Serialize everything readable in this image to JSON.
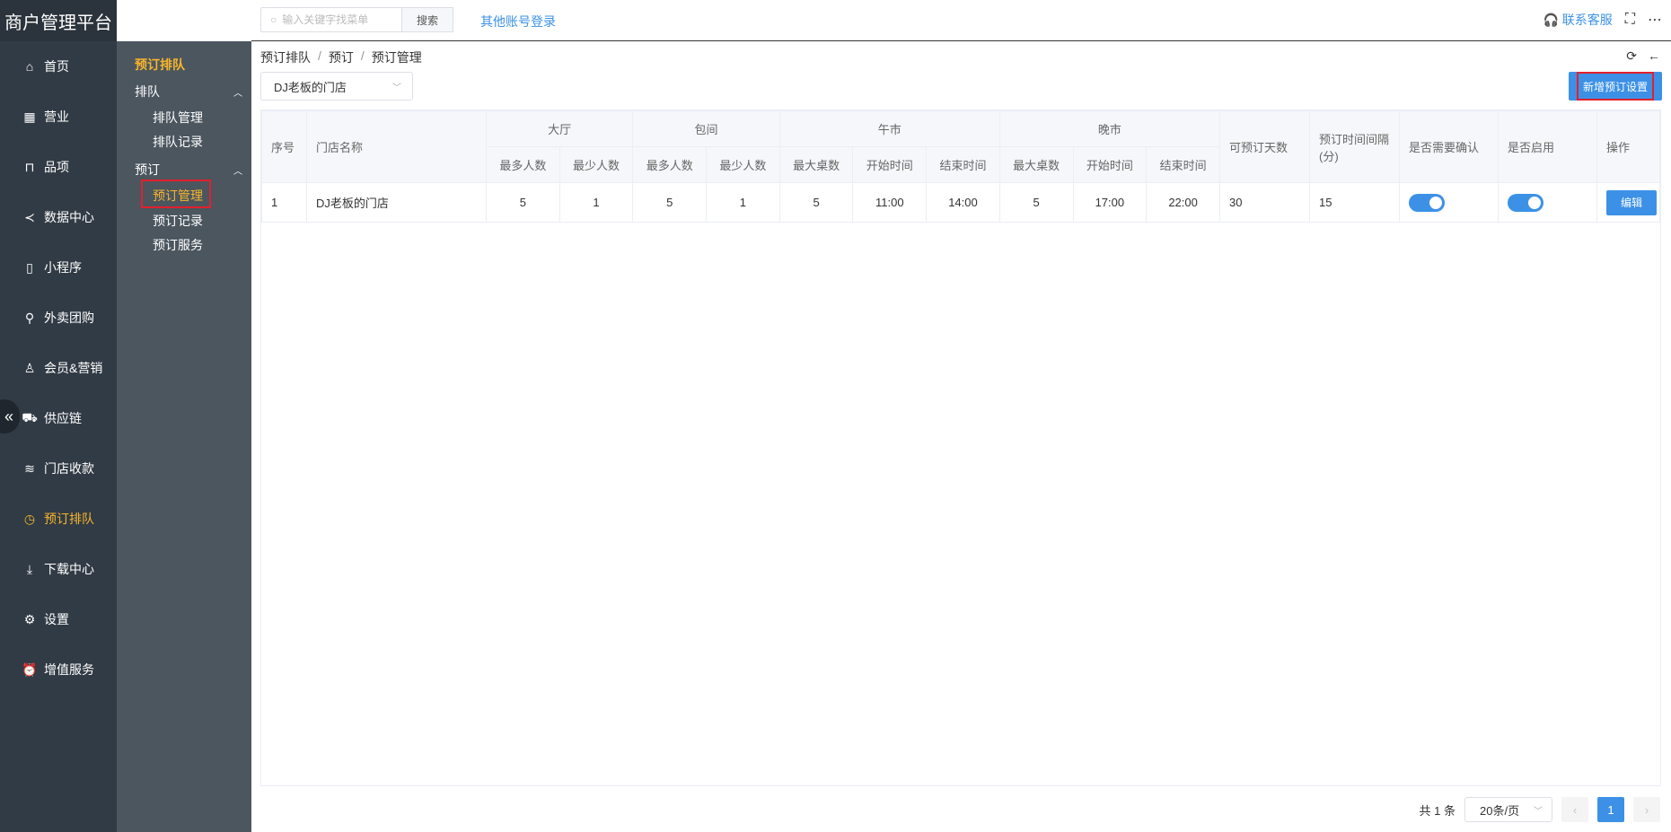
{
  "app": {
    "title": "商户管理平台"
  },
  "nav": [
    {
      "label": "首页",
      "icon": "home-icon",
      "glyph": "⌂"
    },
    {
      "label": "营业",
      "icon": "calendar-icon",
      "glyph": "▦"
    },
    {
      "label": "品项",
      "icon": "bag-icon",
      "glyph": "⊓"
    },
    {
      "label": "数据中心",
      "icon": "share-icon",
      "glyph": "≺"
    },
    {
      "label": "小程序",
      "icon": "phone-icon",
      "glyph": "▯"
    },
    {
      "label": "外卖团购",
      "icon": "bike-icon",
      "glyph": "⚲"
    },
    {
      "label": "会员&营销",
      "icon": "user-icon",
      "glyph": "♙"
    },
    {
      "label": "供应链",
      "icon": "truck-icon",
      "glyph": "⛟"
    },
    {
      "label": "门店收款",
      "icon": "coins-icon",
      "glyph": "≋"
    },
    {
      "label": "预订排队",
      "icon": "clock-icon",
      "glyph": "◷"
    },
    {
      "label": "下载中心",
      "icon": "download-icon",
      "glyph": "⤓"
    },
    {
      "label": "设置",
      "icon": "gear-icon",
      "glyph": "⚙"
    },
    {
      "label": "增值服务",
      "icon": "alarm-icon",
      "glyph": "⏰"
    }
  ],
  "subnav": {
    "title": "预订排队",
    "groups": [
      {
        "label": "排队",
        "items": [
          "排队管理",
          "排队记录"
        ]
      },
      {
        "label": "预订",
        "items": [
          "预订管理",
          "预订记录",
          "预订服务"
        ]
      }
    ]
  },
  "topbar": {
    "search_placeholder": "输入关键字找菜单",
    "search_button": "搜索",
    "other_login": "其他账号登录",
    "contact": "联系客服"
  },
  "breadcrumb": [
    "预订排队",
    "预订",
    "预订管理"
  ],
  "store_select": "DJ老板的门店",
  "add_button": "新增预订设置",
  "table": {
    "headers": {
      "index": "序号",
      "store": "门店名称",
      "hall": "大厅",
      "room": "包间",
      "noon": "午市",
      "evening": "晚市",
      "days": "可预订天数",
      "interval": "预订时间间隔(分)",
      "confirm": "是否需要确认",
      "enabled": "是否启用",
      "action": "操作",
      "max_people": "最多人数",
      "min_people": "最少人数",
      "max_tables": "最大桌数",
      "start_time": "开始时间",
      "end_time": "结束时间"
    },
    "rows": [
      {
        "index": "1",
        "store": "DJ老板的门店",
        "hall_max": "5",
        "hall_min": "1",
        "room_max": "5",
        "room_min": "1",
        "noon_tables": "5",
        "noon_start": "11:00",
        "noon_end": "14:00",
        "eve_tables": "5",
        "eve_start": "17:00",
        "eve_end": "22:00",
        "days": "30",
        "interval": "15",
        "confirm": true,
        "enabled": true,
        "action": "编辑"
      }
    ]
  },
  "pager": {
    "total": "共 1 条",
    "page_size": "20条/页",
    "current": "1"
  }
}
